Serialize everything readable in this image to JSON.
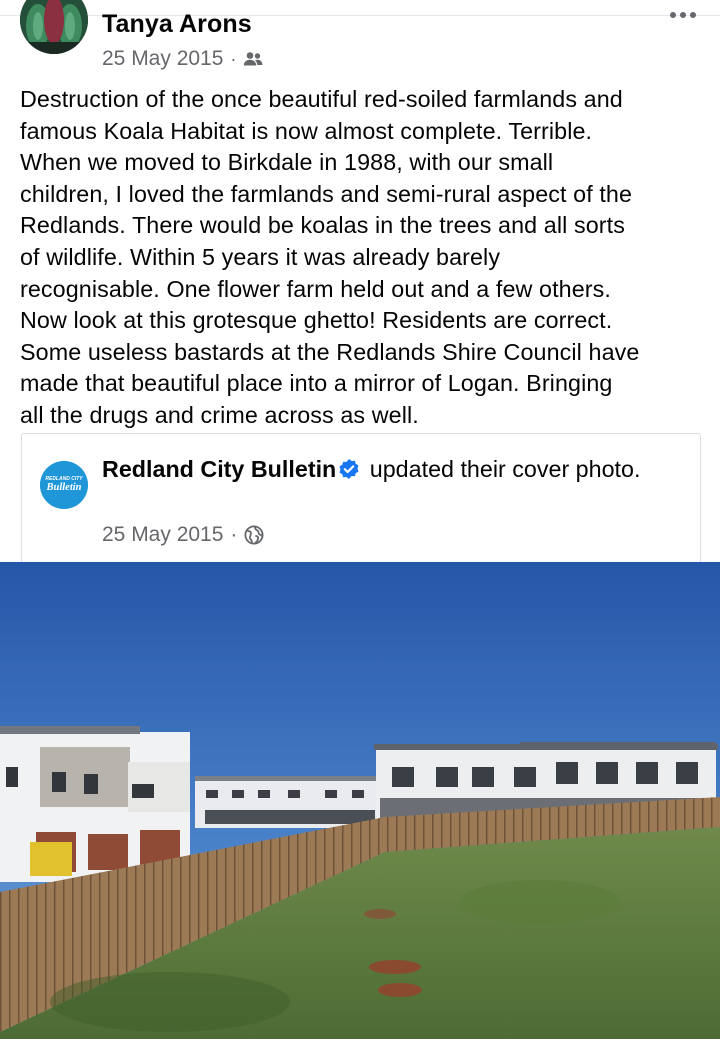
{
  "post": {
    "author": "Tanya Arons",
    "date": "25 May 2015",
    "separator": "·",
    "audience_icon": "friends-icon",
    "text": "Destruction of the once beautiful red-soiled farmlands and\nfamous Koala Habitat is now almost complete.  Terrible.\nWhen we moved to Birkdale in 1988, with our small\nchildren, I loved the farmlands and semi-rural aspect of the\nRedlands.  There would be koalas in the trees and all sorts\nof wildlife.  Within 5 years it was already barely\nrecognisable.  One flower farm held out and a few others.\nNow look at this grotesque ghetto!  Residents are correct.\nSome useless bastards at the Redlands Shire Council have\nmade that beautiful place into a mirror of Logan.  Bringing\nall the drugs and crime across as well."
  },
  "shared": {
    "page_name": "Redland City Bulletin",
    "action": "updated their cover photo.",
    "date": "25 May 2015",
    "separator": "·",
    "audience_icon": "globe-icon",
    "logo_text_top": "REDLAND CITY",
    "logo_text_main": "Bulletin"
  },
  "colors": {
    "meta_gray": "#65676b",
    "verified_blue": "#1877f2",
    "sky": "#2f63b5",
    "logo_blue": "#1e96d7"
  }
}
